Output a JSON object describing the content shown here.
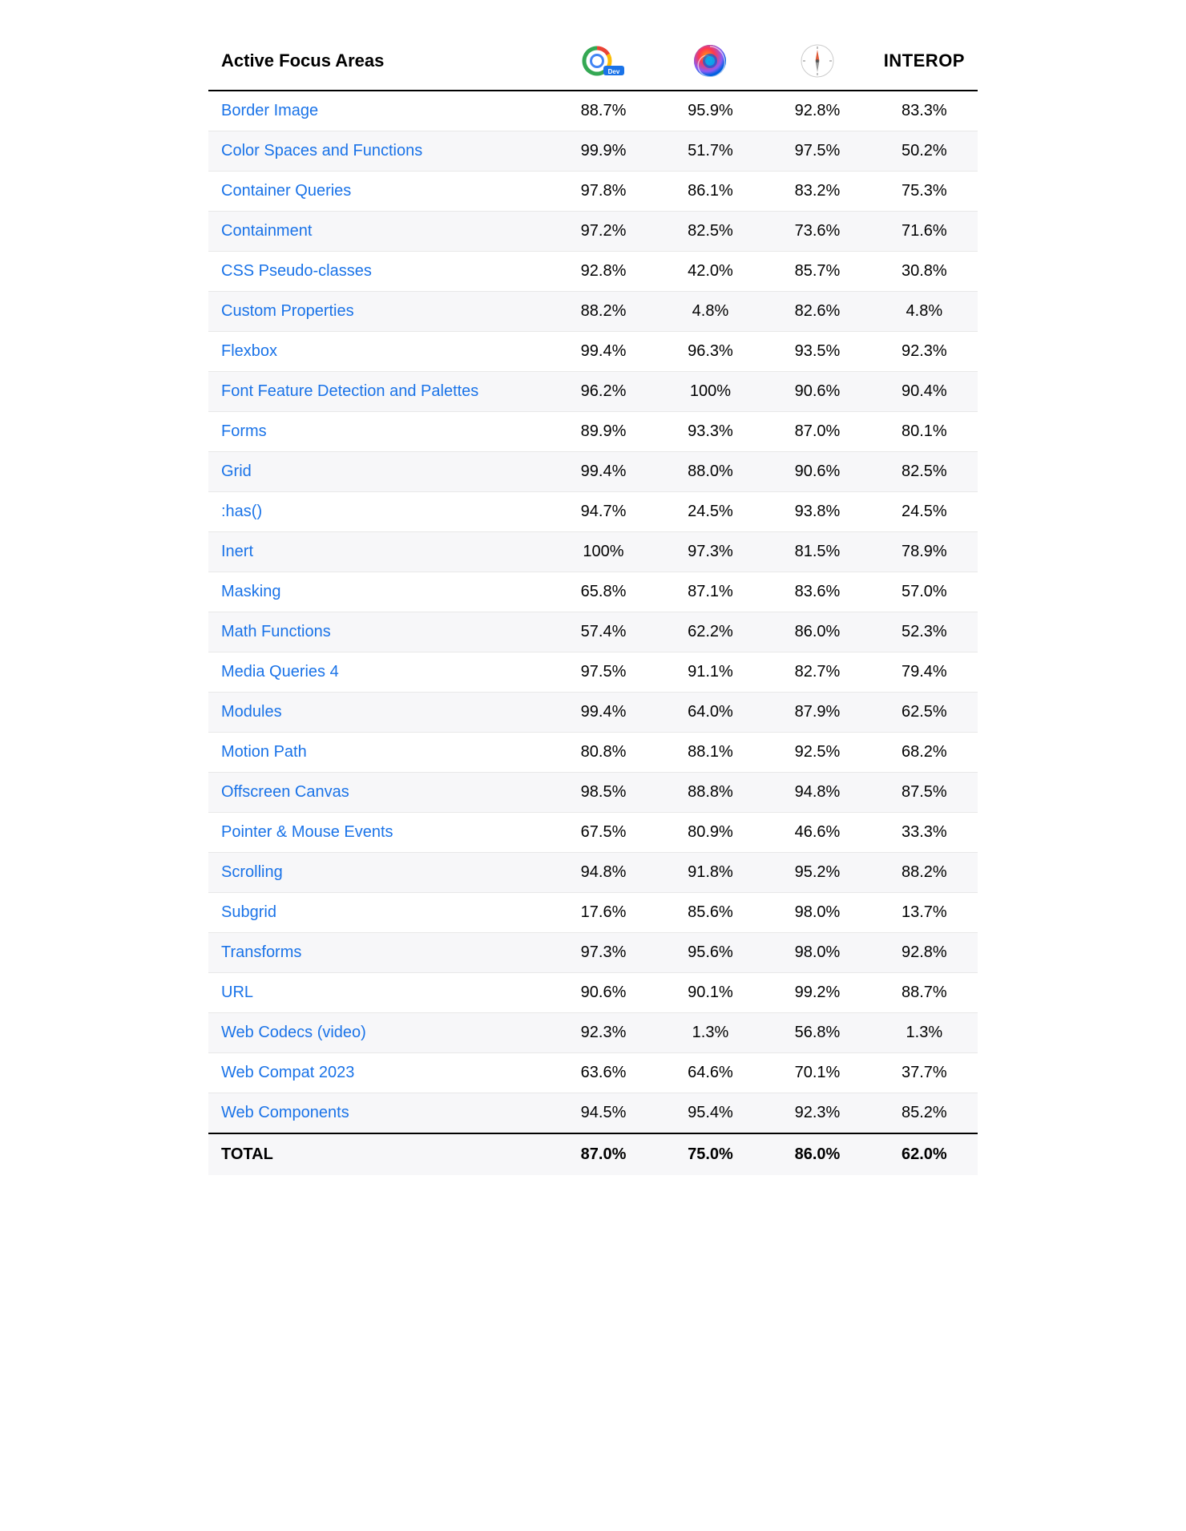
{
  "header": {
    "area_label": "Active Focus Areas",
    "interop_label": "INTEROP"
  },
  "rows": [
    {
      "name": "Border Image",
      "chrome": "88.7%",
      "firefox": "95.9%",
      "safari": "92.8%",
      "interop": "83.3%"
    },
    {
      "name": "Color Spaces and Functions",
      "chrome": "99.9%",
      "firefox": "51.7%",
      "safari": "97.5%",
      "interop": "50.2%"
    },
    {
      "name": "Container Queries",
      "chrome": "97.8%",
      "firefox": "86.1%",
      "safari": "83.2%",
      "interop": "75.3%"
    },
    {
      "name": "Containment",
      "chrome": "97.2%",
      "firefox": "82.5%",
      "safari": "73.6%",
      "interop": "71.6%"
    },
    {
      "name": "CSS Pseudo-classes",
      "chrome": "92.8%",
      "firefox": "42.0%",
      "safari": "85.7%",
      "interop": "30.8%"
    },
    {
      "name": "Custom Properties",
      "chrome": "88.2%",
      "firefox": "4.8%",
      "safari": "82.6%",
      "interop": "4.8%"
    },
    {
      "name": "Flexbox",
      "chrome": "99.4%",
      "firefox": "96.3%",
      "safari": "93.5%",
      "interop": "92.3%"
    },
    {
      "name": "Font Feature Detection and Palettes",
      "chrome": "96.2%",
      "firefox": "100%",
      "safari": "90.6%",
      "interop": "90.4%"
    },
    {
      "name": "Forms",
      "chrome": "89.9%",
      "firefox": "93.3%",
      "safari": "87.0%",
      "interop": "80.1%"
    },
    {
      "name": "Grid",
      "chrome": "99.4%",
      "firefox": "88.0%",
      "safari": "90.6%",
      "interop": "82.5%"
    },
    {
      "name": ":has()",
      "chrome": "94.7%",
      "firefox": "24.5%",
      "safari": "93.8%",
      "interop": "24.5%"
    },
    {
      "name": "Inert",
      "chrome": "100%",
      "firefox": "97.3%",
      "safari": "81.5%",
      "interop": "78.9%"
    },
    {
      "name": "Masking",
      "chrome": "65.8%",
      "firefox": "87.1%",
      "safari": "83.6%",
      "interop": "57.0%"
    },
    {
      "name": "Math Functions",
      "chrome": "57.4%",
      "firefox": "62.2%",
      "safari": "86.0%",
      "interop": "52.3%"
    },
    {
      "name": "Media Queries 4",
      "chrome": "97.5%",
      "firefox": "91.1%",
      "safari": "82.7%",
      "interop": "79.4%"
    },
    {
      "name": "Modules",
      "chrome": "99.4%",
      "firefox": "64.0%",
      "safari": "87.9%",
      "interop": "62.5%"
    },
    {
      "name": "Motion Path",
      "chrome": "80.8%",
      "firefox": "88.1%",
      "safari": "92.5%",
      "interop": "68.2%"
    },
    {
      "name": "Offscreen Canvas",
      "chrome": "98.5%",
      "firefox": "88.8%",
      "safari": "94.8%",
      "interop": "87.5%"
    },
    {
      "name": "Pointer & Mouse Events",
      "chrome": "67.5%",
      "firefox": "80.9%",
      "safari": "46.6%",
      "interop": "33.3%"
    },
    {
      "name": "Scrolling",
      "chrome": "94.8%",
      "firefox": "91.8%",
      "safari": "95.2%",
      "interop": "88.2%"
    },
    {
      "name": "Subgrid",
      "chrome": "17.6%",
      "firefox": "85.6%",
      "safari": "98.0%",
      "interop": "13.7%"
    },
    {
      "name": "Transforms",
      "chrome": "97.3%",
      "firefox": "95.6%",
      "safari": "98.0%",
      "interop": "92.8%"
    },
    {
      "name": "URL",
      "chrome": "90.6%",
      "firefox": "90.1%",
      "safari": "99.2%",
      "interop": "88.7%"
    },
    {
      "name": "Web Codecs (video)",
      "chrome": "92.3%",
      "firefox": "1.3%",
      "safari": "56.8%",
      "interop": "1.3%"
    },
    {
      "name": "Web Compat 2023",
      "chrome": "63.6%",
      "firefox": "64.6%",
      "safari": "70.1%",
      "interop": "37.7%"
    },
    {
      "name": "Web Components",
      "chrome": "94.5%",
      "firefox": "95.4%",
      "safari": "92.3%",
      "interop": "85.2%"
    }
  ],
  "footer": {
    "total_label": "TOTAL",
    "chrome": "87.0%",
    "firefox": "75.0%",
    "safari": "86.0%",
    "interop": "62.0%"
  }
}
